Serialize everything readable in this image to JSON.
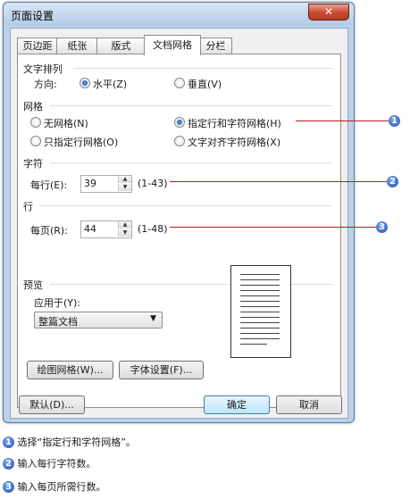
{
  "window": {
    "title": "页面设置",
    "close_glyph": "✕"
  },
  "tabs": [
    "页边距",
    "纸张",
    "版式",
    "文档网格",
    "分栏"
  ],
  "text_direction": {
    "heading": "文字排列",
    "direction_label": "方向:",
    "horizontal": "水平(Z)",
    "vertical": "垂直(V)"
  },
  "grid": {
    "heading": "网格",
    "no_grid": "无网格(N)",
    "line_and_char": "指定行和字符网格(H)",
    "line_only": "只指定行网格(O)",
    "snap_char": "文字对齐字符网格(X)"
  },
  "characters": {
    "heading": "字符",
    "per_line_label": "每行(E):",
    "per_line_value": "39",
    "range": "(1-43)"
  },
  "lines": {
    "heading": "行",
    "per_page_label": "每页(R):",
    "per_page_value": "44",
    "range": "(1-48)"
  },
  "preview": {
    "heading": "预览",
    "apply_to_label": "应用于(Y):",
    "apply_to_value": "整篇文档"
  },
  "buttons": {
    "draw_grid": "绘图网格(W)...",
    "font_settings": "字体设置(F)...",
    "default": "默认(D)...",
    "ok": "确定",
    "cancel": "取消"
  },
  "callouts": [
    "1",
    "2",
    "3"
  ],
  "notes": [
    {
      "num": "1",
      "text": "选择“指定行和字符网格”。"
    },
    {
      "num": "2",
      "text": "输入每行字符数。"
    },
    {
      "num": "3",
      "text": "输入每页所需行数。"
    }
  ],
  "colors": {
    "leader": "#c2191f",
    "callout": "#1f4fb0",
    "close": "#c74a30"
  }
}
